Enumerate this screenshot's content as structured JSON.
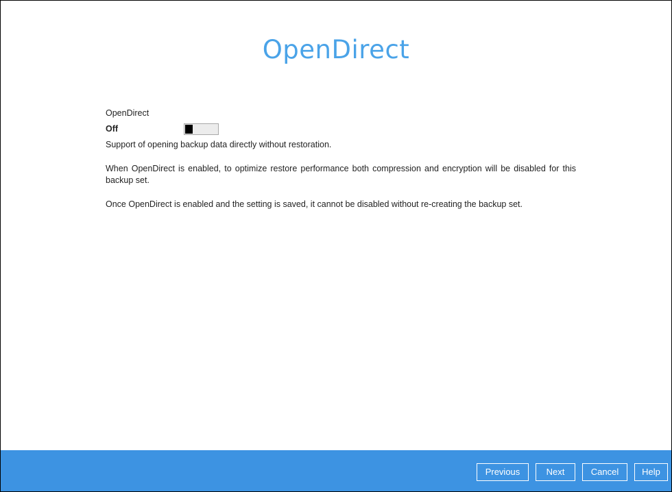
{
  "page": {
    "title": "OpenDirect"
  },
  "setting": {
    "label": "OpenDirect",
    "state_text": "Off",
    "enabled": false,
    "description": "Support of opening backup data directly without restoration.",
    "note_1": "When OpenDirect is enabled, to optimize restore performance both compression and encryption will be disabled for this backup set.",
    "note_2": "Once OpenDirect is enabled and the setting is saved, it cannot be disabled without re-creating the backup set."
  },
  "footer": {
    "previous_label": "Previous",
    "next_label": "Next",
    "cancel_label": "Cancel",
    "help_label": "Help"
  },
  "colors": {
    "title": "#4aa3e8",
    "footer_background": "#3d93e2",
    "button_border": "#ffffff"
  }
}
